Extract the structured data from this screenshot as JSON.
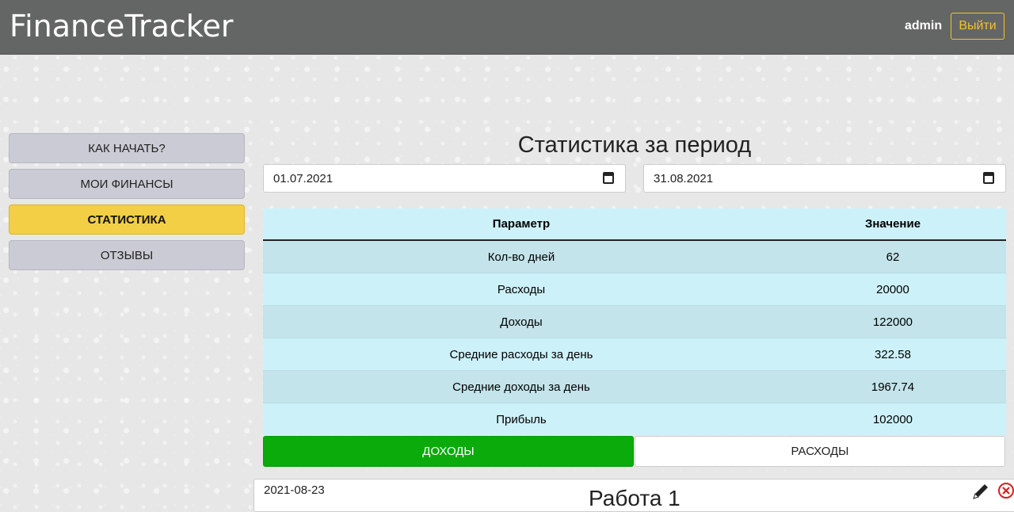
{
  "header": {
    "brand": "FinanceTracker",
    "user": "admin",
    "logout_label": "Выйти"
  },
  "sidebar": {
    "items": [
      {
        "label": "КАК НАЧАТЬ?"
      },
      {
        "label": "МОИ ФИНАНСЫ"
      },
      {
        "label": "СТАТИСТИКА",
        "active": true
      },
      {
        "label": "ОТЗЫВЫ"
      }
    ]
  },
  "main": {
    "title": "Статистика за период",
    "date_from": "01.07.2021",
    "date_to": "31.08.2021",
    "table": {
      "headers": [
        "Параметр",
        "Значение"
      ],
      "rows": [
        [
          "Кол-во дней",
          "62"
        ],
        [
          "Расходы",
          "20000"
        ],
        [
          "Доходы",
          "122000"
        ],
        [
          "Средние расходы за день",
          "322.58"
        ],
        [
          "Средние доходы за день",
          "1967.74"
        ],
        [
          "Прибыль",
          "102000"
        ]
      ]
    },
    "tabs": {
      "income_label": "ДОХОДЫ",
      "expense_label": "РАСХОДЫ",
      "active": "income"
    },
    "entry": {
      "date": "2021-08-23",
      "title": "Работа 1"
    }
  },
  "colors": {
    "header_bg": "#646665",
    "accent": "#f2c12e",
    "active_tab": "#0aab0a",
    "table_row": "#cdf1f9"
  },
  "icons": [
    "calendar-icon",
    "edit-pencil-icon",
    "delete-x-icon"
  ]
}
